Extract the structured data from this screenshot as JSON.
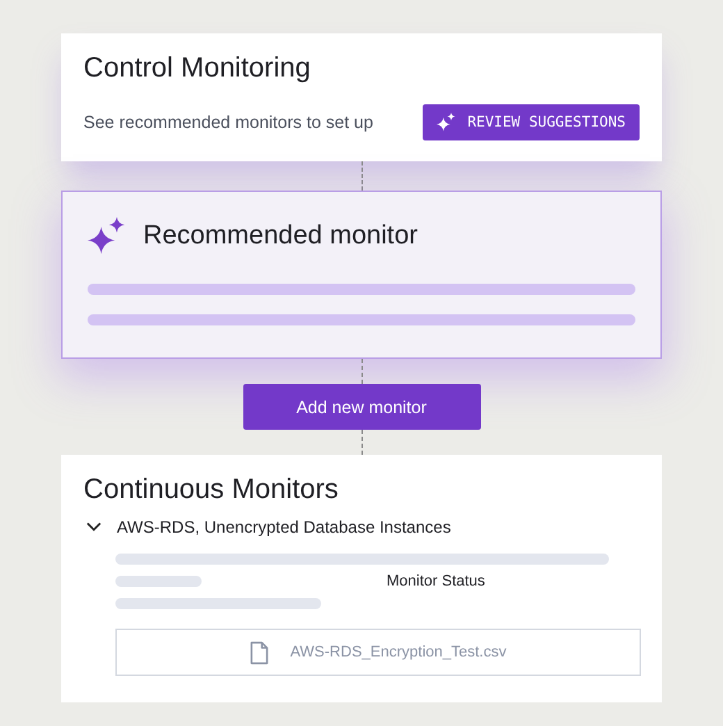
{
  "control_card": {
    "title": "Control Monitoring",
    "description": "See recommended monitors to set up",
    "button": "REVIEW SUGGESTIONS"
  },
  "recommended_card": {
    "title": "Recommended monitor"
  },
  "add_button": "Add new monitor",
  "monitors_card": {
    "title": "Continuous Monitors",
    "monitor": {
      "name": "AWS-RDS, Unencrypted Database Instances",
      "expanded": true,
      "status_label": "Monitor Status",
      "file": "AWS-RDS_Encryption_Test.csv"
    }
  }
}
